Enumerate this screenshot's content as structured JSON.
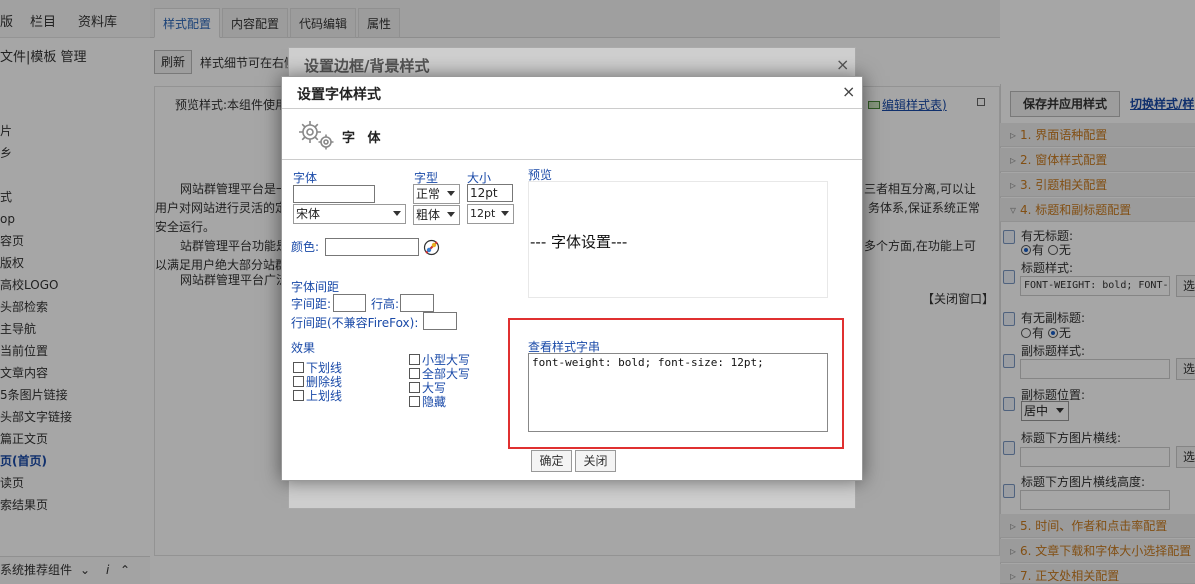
{
  "left_tabs": [
    "版",
    "栏目",
    "资料库"
  ],
  "left_sub": "文件|模板 管理",
  "left_items": [
    "",
    "片",
    "乡",
    "",
    "式",
    "op",
    "容页",
    "版权",
    "高校LOGO",
    "头部检索",
    "主导航",
    "当前位置",
    "文章内容",
    "5条图片链接",
    "头部文字链接",
    "篇正文页",
    "页(首页)",
    "读页",
    "索结果页"
  ],
  "left_footer": "系统推荐组件",
  "main_tabs": [
    "样式配置",
    "内容配置",
    "代码编辑",
    "属性"
  ],
  "refresh_label": "刷新",
  "hint_text": "样式细节可在右侧",
  "preview_label": "预览样式:本组件使用",
  "edit_style_link": "编辑样式表)",
  "paragraphs": [
    {
      "text": "网站群管理平台是一",
      "tail": "三者相互分离,可以让"
    },
    {
      "text": "用户对网站进行灵活的定",
      "tail": "务体系,保证系统正常"
    },
    {
      "text": "安全运行。",
      "tail": ""
    },
    {
      "text": "站群管理平台功能是",
      "tail": "多个方面,在功能上可"
    },
    {
      "text": "以满足用户绝大部分站群",
      "tail": ""
    },
    {
      "text": "网站群管理平台广泛",
      "tail": ""
    }
  ],
  "close_window": "【关闭窗口】",
  "right_panel": {
    "save_apply": "保存并应用样式",
    "switch_link": "切换样式/样",
    "sections": [
      "1. 界面语种配置",
      "2. 窗体样式配置",
      "3. 引题相关配置",
      "4. 标题和副标题配置"
    ],
    "has_title": "有无标题:",
    "has_title_opts": [
      "有",
      "无"
    ],
    "title_style_label": "标题样式:",
    "title_style_value": "FONT-WEIGHT: bold; FONT-",
    "has_subtitle": "有无副标题:",
    "has_subtitle_opts": [
      "有",
      "无"
    ],
    "subtitle_style_label": "副标题样式:",
    "subtitle_pos_label": "副标题位置:",
    "subtitle_pos_value": "居中",
    "title_img_line": "标题下方图片横线:",
    "title_img_height": "标题下方图片横线高度:",
    "btn_char": "选",
    "sections_lower": [
      "5. 时间、作者和点击率配置",
      "6. 文章下载和字体大小选择配置",
      "7. 正文处相关配置"
    ]
  },
  "back_dialog": {
    "title": "设置边框/背景样式",
    "close": "×"
  },
  "dialog": {
    "title": "设置字体样式",
    "close": "×",
    "section_title": "字 体",
    "font_label": "字体",
    "font_value": "",
    "font_select": "宋体",
    "style_label": "字型",
    "style_select": "正常",
    "weight_select": "粗体",
    "size_label": "大小",
    "size_value": "12pt",
    "size_select": "12pt",
    "preview_label": "预览",
    "preview_text": "--- 字体设置---",
    "color_label": "颜色:",
    "spacing_title": "字体间距",
    "letter_spacing": "字间距:",
    "line_height": "行高:",
    "line_spacing": "行间距(不兼容FireFox):",
    "effects_title": "效果",
    "effects_left": [
      "下划线",
      "删除线",
      "上划线"
    ],
    "effects_right": [
      "小型大写",
      "全部大写",
      "大写",
      "隐藏"
    ],
    "style_string_label": "查看样式字串",
    "style_string_value": "font-weight: bold; font-size: 12pt;",
    "ok_button": "确定",
    "close_button": "关闭"
  }
}
